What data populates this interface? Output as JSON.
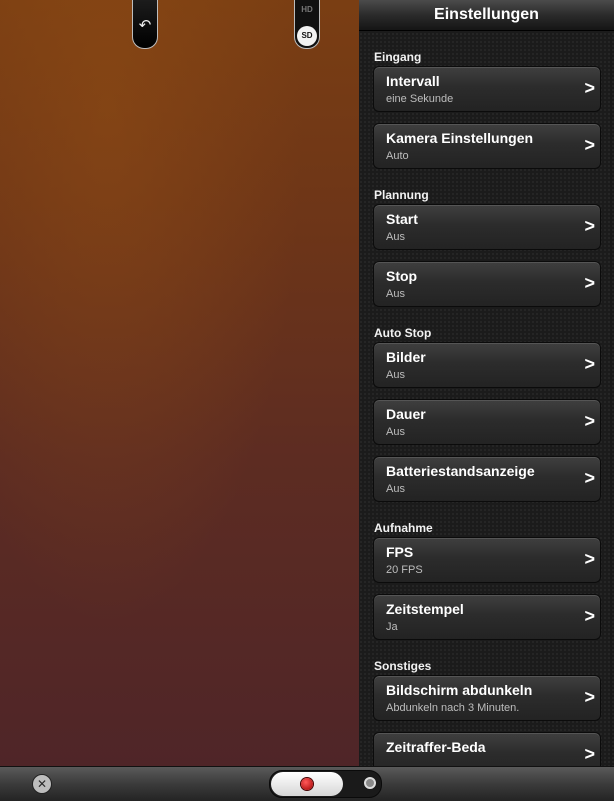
{
  "header": {
    "title": "Einstellungen"
  },
  "camera_overlay": {
    "switch_camera_icon": "camera-switch-icon",
    "resolution_options": [
      "HD",
      "SD"
    ],
    "resolution_selected": "SD"
  },
  "sections": [
    {
      "title": "Eingang",
      "items": [
        {
          "title": "Intervall",
          "value": "eine Sekunde"
        },
        {
          "title": "Kamera Einstellungen",
          "value": "Auto"
        }
      ]
    },
    {
      "title": "Plannung",
      "items": [
        {
          "title": "Start",
          "value": "Aus"
        },
        {
          "title": "Stop",
          "value": "Aus"
        }
      ]
    },
    {
      "title": "Auto Stop",
      "items": [
        {
          "title": "Bilder",
          "value": "Aus"
        },
        {
          "title": "Dauer",
          "value": "Aus"
        },
        {
          "title": "Batteriestandsanzeige",
          "value": "Aus"
        }
      ]
    },
    {
      "title": "Aufnahme",
      "items": [
        {
          "title": "FPS",
          "value": "20 FPS"
        },
        {
          "title": "Zeitstempel",
          "value": "Ja"
        }
      ]
    },
    {
      "title": "Sonstiges",
      "items": [
        {
          "title": "Bildschirm abdunkeln",
          "value": "Abdunkeln nach 3 Minuten."
        },
        {
          "title": "Zeitraffer-Beda",
          "value": ""
        }
      ]
    }
  ],
  "chevron": ">",
  "toolbar": {
    "close_icon": "close-icon",
    "close_glyph": "✕",
    "mode": "record"
  },
  "colors": {
    "record": "#d40000",
    "panel_bg": "#1b1b1b",
    "preview": "#6d3518"
  }
}
